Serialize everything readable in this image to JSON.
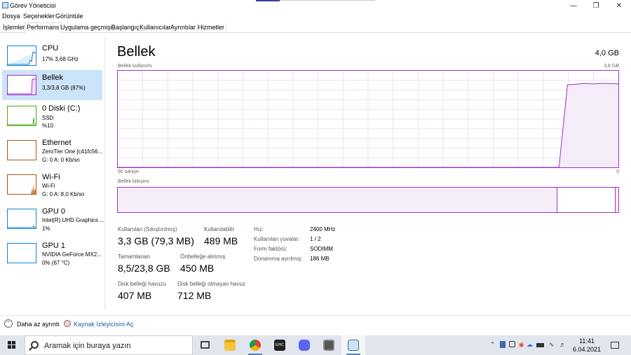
{
  "window": {
    "title": "Görev Yöneticisi"
  },
  "menu": {
    "file": "Dosya",
    "options": "Seçenekler",
    "view": "Görüntüle"
  },
  "tabs": [
    "İşlemler",
    "Performans",
    "Uygulama geçmişi",
    "Başlangıç",
    "Kullanıcılar",
    "Ayrıntılar",
    "Hizmetler"
  ],
  "active_tab": "Performans",
  "sidebar": [
    {
      "name": "CPU",
      "lines": [
        "17%  3,68 GHz"
      ],
      "color": "#1184d7"
    },
    {
      "name": "Bellek",
      "lines": [
        "3,3/3,8 GB (87%)"
      ],
      "color": "#9e30c9"
    },
    {
      "name": "0 Diski (C:)",
      "lines": [
        "SSD",
        "%10"
      ],
      "color": "#4da60c"
    },
    {
      "name": "Ethernet",
      "lines": [
        "ZeroTier One [c41fc56...",
        "G: 0  A: 0 Kb/sn"
      ],
      "color": "#a7581b"
    },
    {
      "name": "Wi-Fi",
      "lines": [
        "Wi-Fi",
        "G: 0  A: 8,0 Kb/sn"
      ],
      "color": "#a7581b"
    },
    {
      "name": "GPU 0",
      "lines": [
        "Intel(R) UHD Graphics ...",
        "1%"
      ],
      "color": "#1184d7"
    },
    {
      "name": "GPU 1",
      "lines": [
        "NVIDIA GeForce MX2...",
        "0% (67 °C)"
      ],
      "color": "#1184d7"
    }
  ],
  "main": {
    "title": "Bellek",
    "total": "4,0 GB",
    "usage_label": "Bellek kullanımı",
    "usage_max": "3,8 GB",
    "time_label": "60 saniye",
    "zero_label": "0",
    "composition_label": "Bellek bileşimi",
    "stats": {
      "in_use_label": "Kullanılan (Sıkıştırılmış)",
      "in_use_value": "3,3 GB (79,3 MB)",
      "available_label": "Kullanılabilir",
      "available_value": "489 MB",
      "committed_label": "Tamamlanan",
      "committed_value": "8,5/23,8 GB",
      "cached_label": "Önbelleğe alınmış",
      "cached_value": "450 MB",
      "paged_label": "Disk belleği havuzu",
      "paged_value": "407 MB",
      "nonpaged_label": "Disk belleği olmayan havuz",
      "nonpaged_value": "712 MB"
    },
    "specs": [
      {
        "label": "Hız:",
        "value": "2400 MHz"
      },
      {
        "label": "Kullanılan yuvalar:",
        "value": "1 / 2"
      },
      {
        "label": "Form faktörü:",
        "value": "SODIMM"
      },
      {
        "label": "Donanıma ayrılmış:",
        "value": "186 MB"
      }
    ],
    "usage_series": [
      0,
      0,
      0,
      0,
      0,
      0,
      0,
      0,
      0,
      0,
      0,
      0,
      0,
      0,
      0,
      0,
      0,
      0,
      0,
      0,
      0,
      0,
      0,
      0,
      0,
      0,
      0,
      0,
      0,
      0,
      0,
      0,
      0,
      0,
      0,
      0,
      0,
      0,
      0,
      0,
      0,
      0,
      0,
      0,
      0,
      0,
      0,
      0,
      0,
      0,
      0,
      0,
      0,
      3.25,
      3.27,
      3.3,
      3.28,
      3.3,
      3.3,
      3.28
    ]
  },
  "footer": {
    "fewer": "Daha az ayrıntı",
    "resmon": "Kaynak İzleyicisini Aç"
  },
  "taskbar": {
    "search_placeholder": "Aramak için buraya yazın",
    "time": "11:41",
    "date": "6.04.2021"
  }
}
